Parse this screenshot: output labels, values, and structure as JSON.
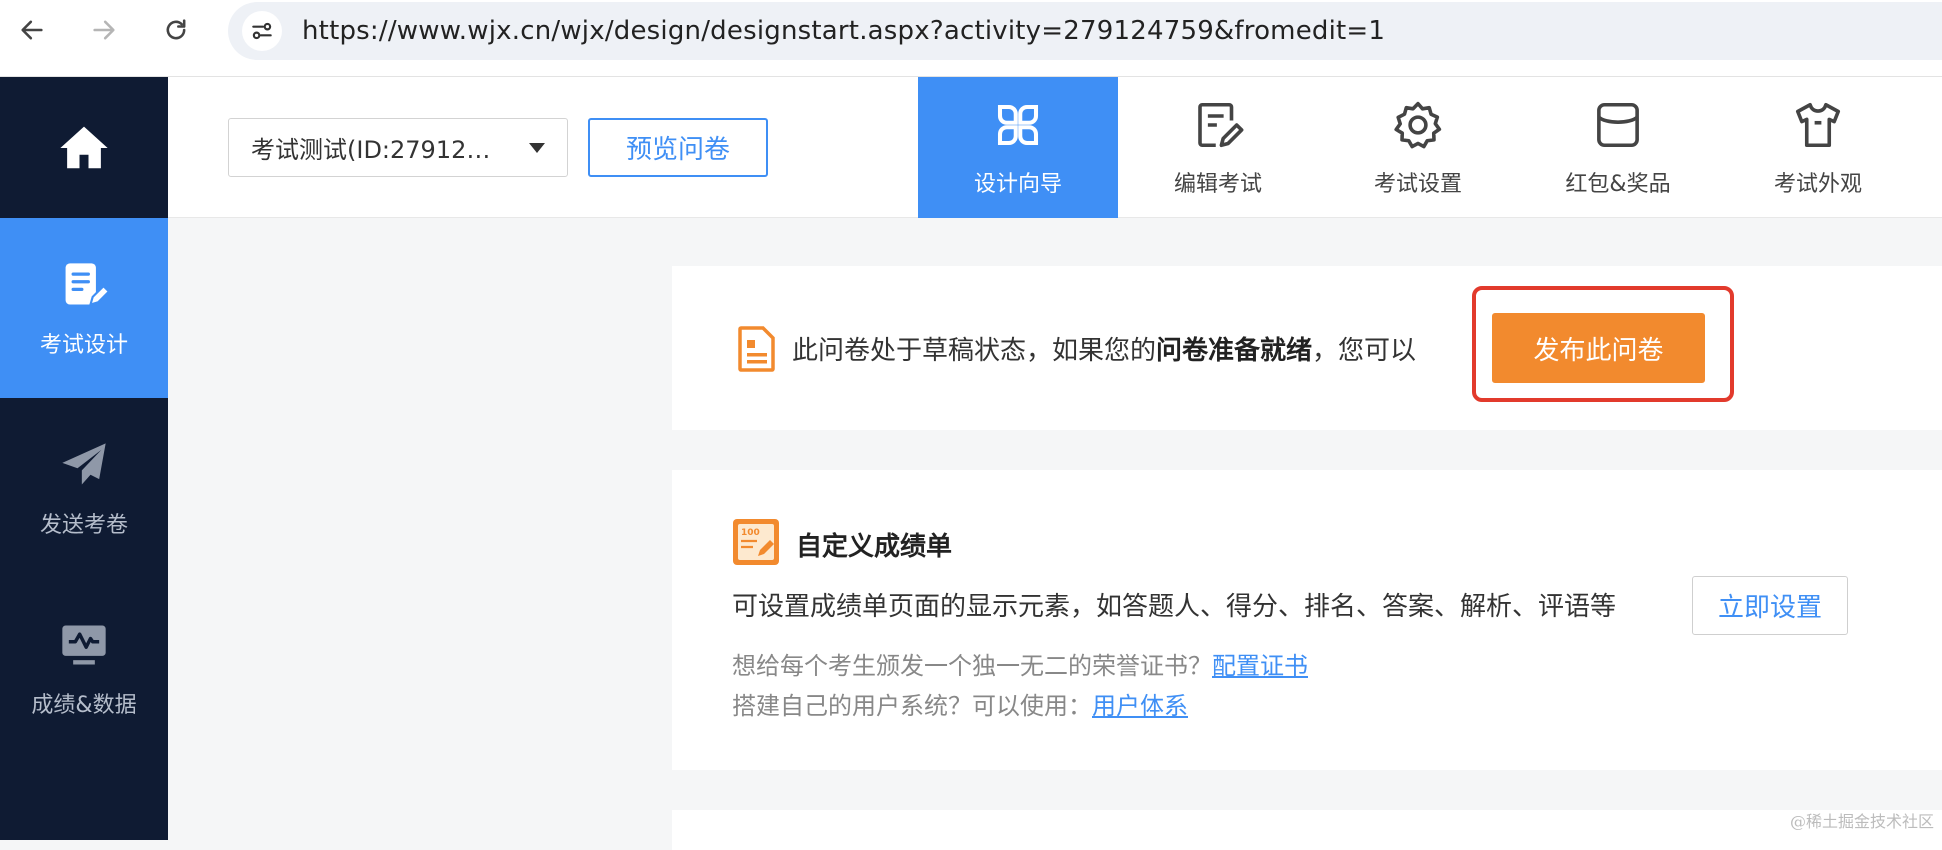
{
  "browser": {
    "url": "https://www.wjx.cn/wjx/design/designstart.aspx?activity=279124759&fromedit=1"
  },
  "sidebar": {
    "home_icon": "home-icon",
    "items": [
      {
        "label": "考试设计",
        "icon": "document-edit-icon",
        "active": true
      },
      {
        "label": "发送考卷",
        "icon": "paper-plane-icon",
        "active": false
      },
      {
        "label": "成绩&数据",
        "icon": "monitor-chart-icon",
        "active": false
      }
    ]
  },
  "header": {
    "survey_select": "考试测试(ID:27912…",
    "preview_label": "预览问卷",
    "tabs": [
      {
        "label": "设计向导",
        "icon": "grid-icon",
        "active": true
      },
      {
        "label": "编辑考试",
        "icon": "edit-doc-icon",
        "active": false
      },
      {
        "label": "考试设置",
        "icon": "gear-icon",
        "active": false
      },
      {
        "label": "红包&奖品",
        "icon": "gift-box-icon",
        "active": false
      },
      {
        "label": "考试外观",
        "icon": "shirt-icon",
        "active": false
      }
    ]
  },
  "status_card": {
    "text_before": "此问卷处于草稿状态，如果您的",
    "text_bold": "问卷准备就绪",
    "text_after": "，您可以",
    "publish_label": "发布此问卷"
  },
  "score_card": {
    "title": "自定义成绩单",
    "description": "可设置成绩单页面的显示元素，如答题人、得分、排名、答案、解析、评语等",
    "setup_label": "立即设置",
    "hint1_text": "想给每个考生颁发一个独一无二的荣誉证书？",
    "hint1_link": "配置证书",
    "hint2_text": "搭建自己的用户系统？可以使用：",
    "hint2_link": "用户体系"
  },
  "watermark": "@稀土掘金技术社区",
  "colors": {
    "sidebar_bg": "#0f1b33",
    "accent_blue": "#3f8ff5",
    "publish_orange": "#f28a2e",
    "highlight_red": "#e23a2c"
  }
}
